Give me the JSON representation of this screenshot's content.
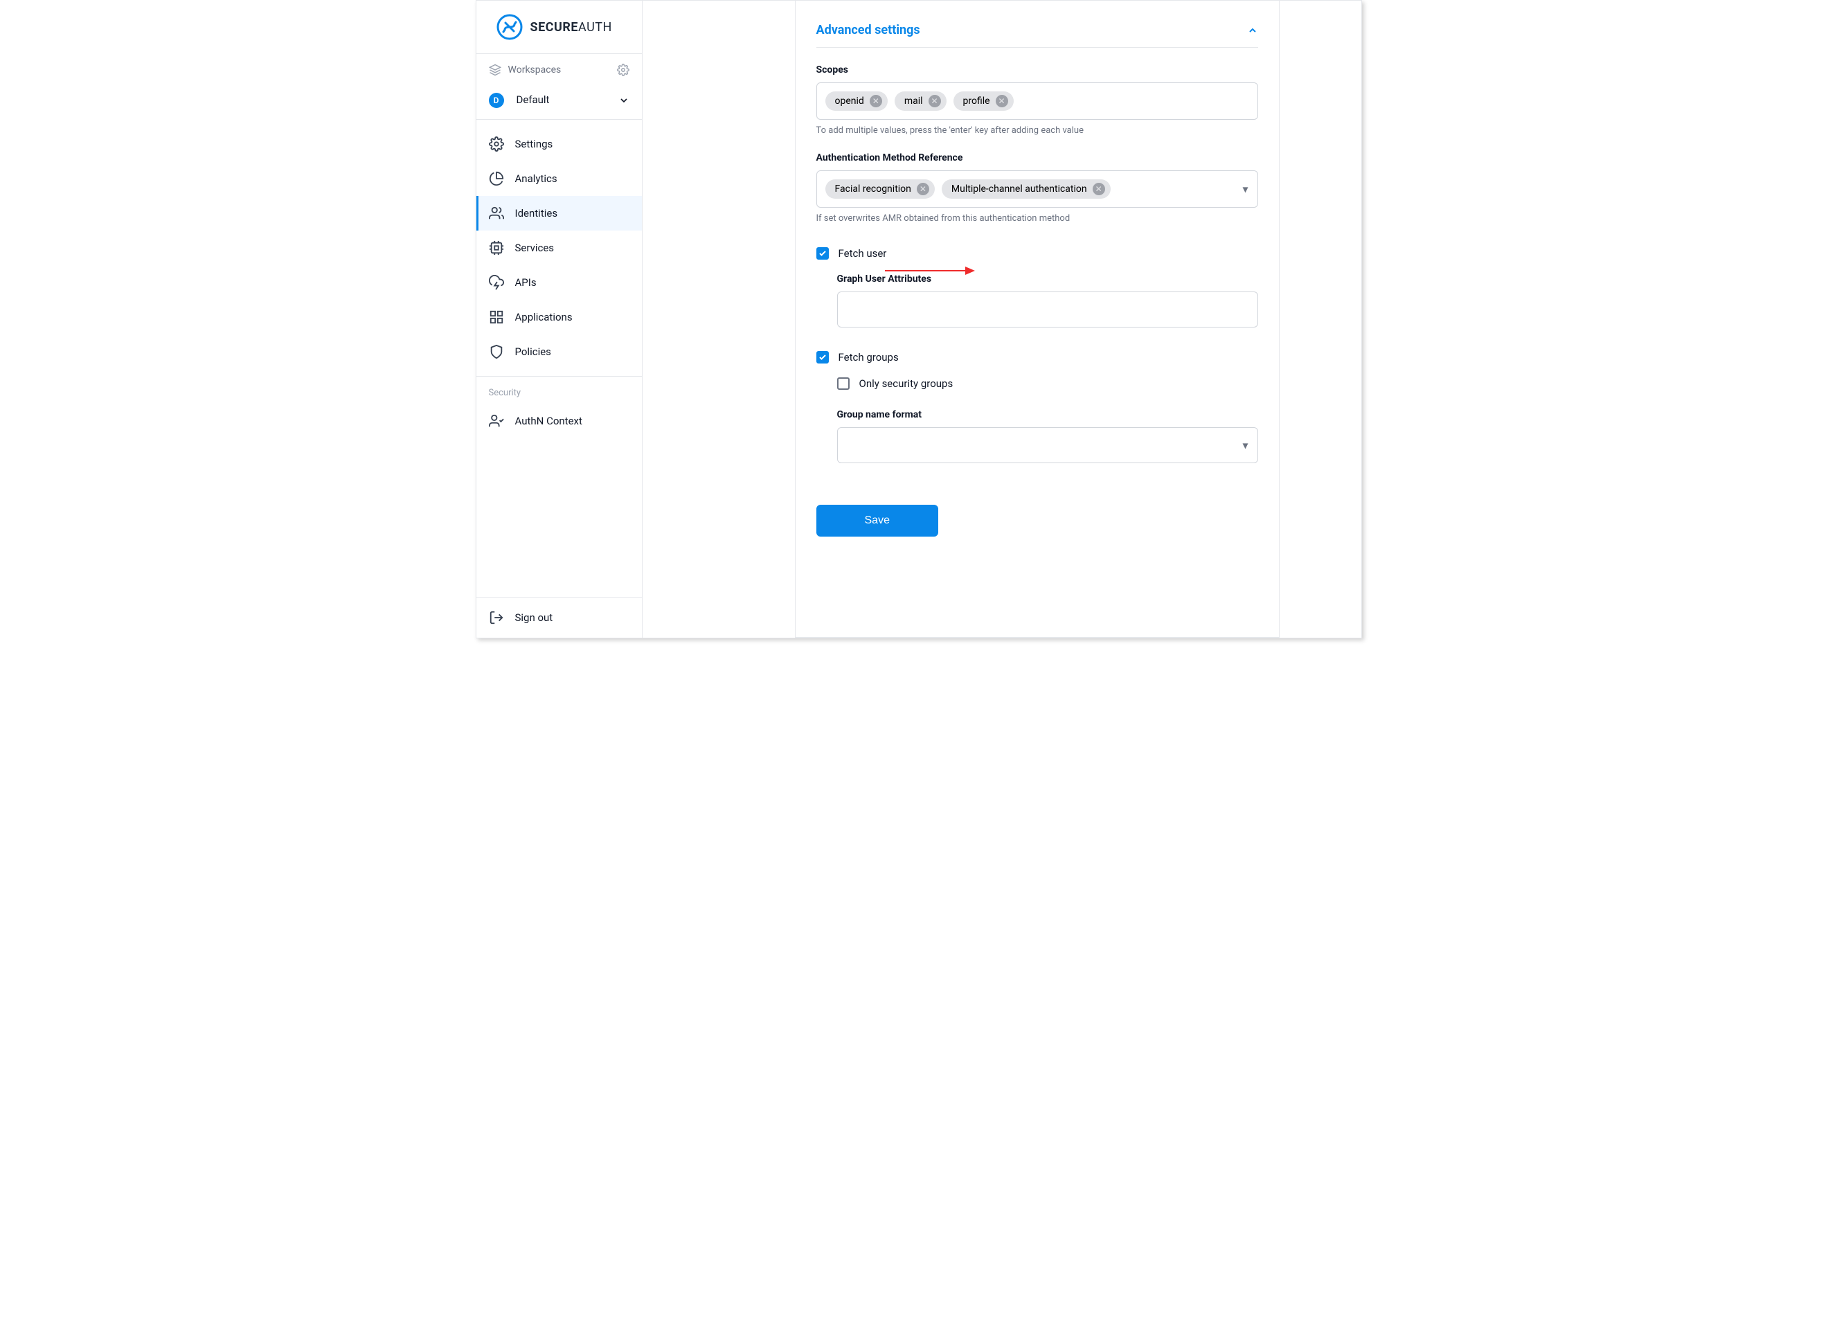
{
  "brand": {
    "logo_label": "SecureAuth logo",
    "name_bold": "SECURE",
    "name_light": "AUTH"
  },
  "workspaces": {
    "label": "Workspaces",
    "current_letter": "D",
    "current_name": "Default"
  },
  "nav": {
    "settings": "Settings",
    "analytics": "Analytics",
    "identities": "Identities",
    "services": "Services",
    "apis": "APIs",
    "applications": "Applications",
    "policies": "Policies"
  },
  "security_section": {
    "label": "Security",
    "authn_context": "AuthN Context"
  },
  "signout": "Sign out",
  "panel": {
    "title": "Advanced settings",
    "scopes": {
      "label": "Scopes",
      "chips": [
        "openid",
        "mail",
        "profile"
      ],
      "hint": "To add multiple values, press the 'enter' key after adding each value"
    },
    "amr": {
      "label": "Authentication Method Reference",
      "chips": [
        "Facial recognition",
        "Multiple-channel authentication"
      ],
      "hint": "If set overwrites AMR obtained from this authentication method"
    },
    "fetch_user": {
      "label": "Fetch user",
      "checked": true,
      "graph_label": "Graph User Attributes",
      "graph_value": ""
    },
    "fetch_groups": {
      "label": "Fetch groups",
      "checked": true,
      "only_security": {
        "label": "Only security groups",
        "checked": false
      },
      "group_format_label": "Group name format",
      "group_format_value": ""
    },
    "save": "Save"
  }
}
